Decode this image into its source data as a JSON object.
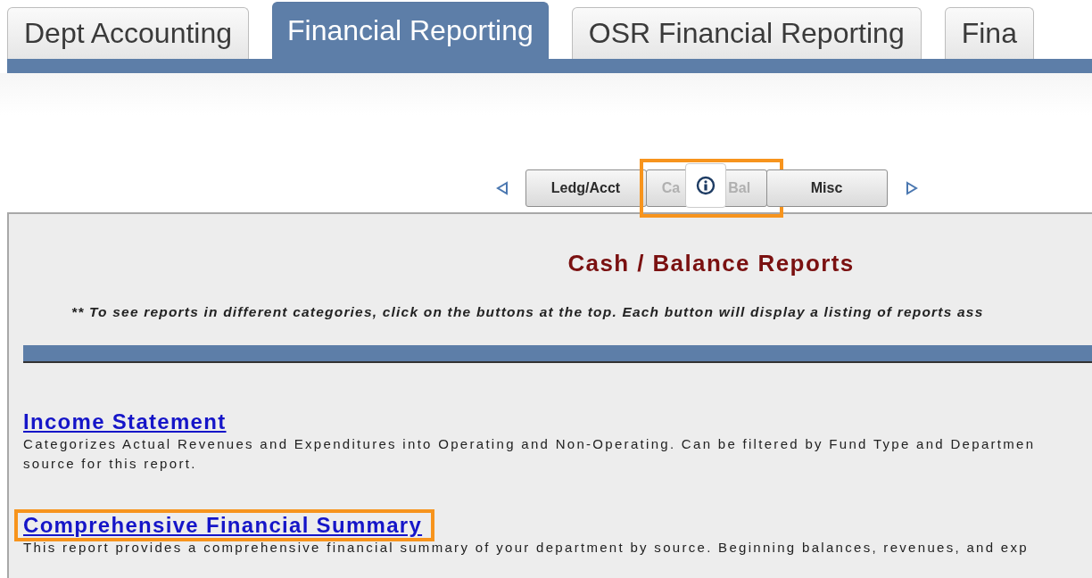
{
  "tabs": [
    {
      "label": "Dept Accounting",
      "selected": false
    },
    {
      "label": "Financial Reporting",
      "selected": true
    },
    {
      "label": "OSR Financial Reporting",
      "selected": false
    },
    {
      "label": "Fina",
      "selected": false
    }
  ],
  "category_nav": {
    "buttons": [
      {
        "label_start": "Ledg/Acct",
        "disabled": false,
        "highlighted": false,
        "covered": false
      },
      {
        "label_start": "Ca",
        "label_end": "Bal",
        "disabled": true,
        "highlighted": true,
        "covered": true
      },
      {
        "label_start": "Misc",
        "disabled": false,
        "highlighted": false,
        "covered": false
      }
    ]
  },
  "section": {
    "title": "Cash / Balance Reports",
    "instructions": "** To see reports in different categories, click on the buttons at the top.  Each button will display a listing of reports ass"
  },
  "reports": [
    {
      "title": "Income Statement",
      "highlighted": false,
      "description": [
        "Categorizes Actual Revenues and Expenditures into Operating and Non-Operating.  Can be filtered by Fund Type and Departmen",
        "source for this report."
      ]
    },
    {
      "title": "Comprehensive Financial Summary",
      "highlighted": true,
      "description": [
        "This report provides a comprehensive financial summary of your department by source.   Beginning balances, revenues, and exp"
      ]
    }
  ]
}
